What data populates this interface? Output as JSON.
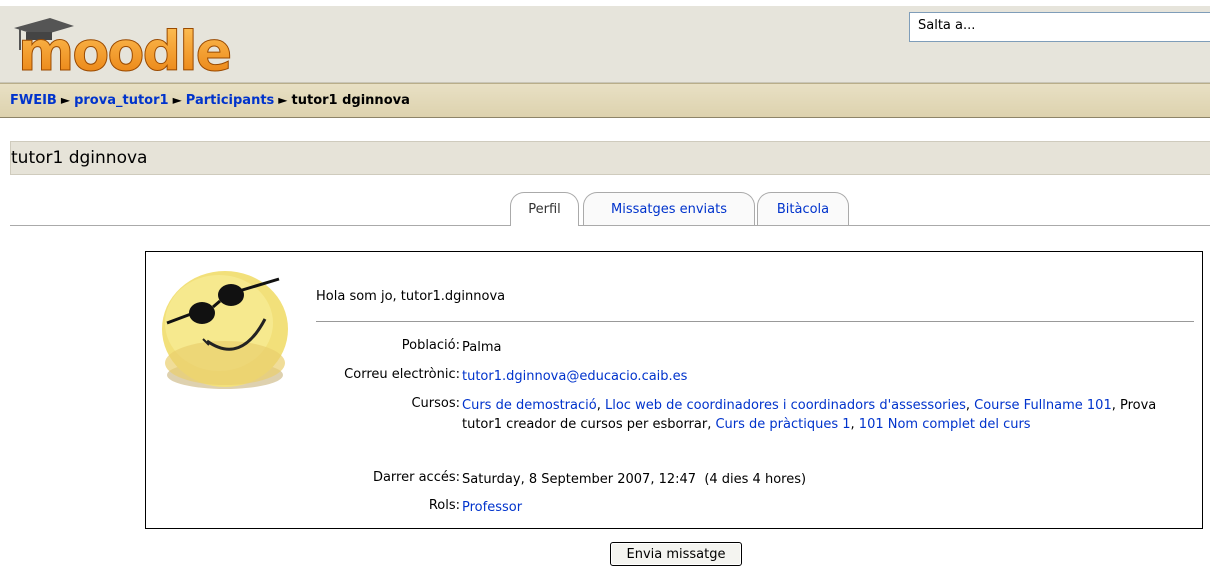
{
  "header": {
    "logo_text": "moodle",
    "jump_menu": "Salta a..."
  },
  "breadcrumb": {
    "items": [
      {
        "label": "FWEIB",
        "link": false
      },
      {
        "label": "prova_tutor1",
        "link": true
      },
      {
        "label": "Participants",
        "link": true
      },
      {
        "label": "tutor1 dginnova",
        "link": false
      }
    ],
    "separator": "►"
  },
  "page_title": "tutor1 dginnova",
  "tabs": [
    {
      "label": "Perfil",
      "active": true
    },
    {
      "label": "Missatges enviats",
      "active": false
    },
    {
      "label": "Bitàcola",
      "active": false
    }
  ],
  "profile": {
    "description": "Hola som jo, tutor1.dginnova",
    "fields": {
      "city_label": "Població:",
      "city_value": "Palma",
      "email_label": "Correu electrònic:",
      "email_value": "tutor1.dginnova@educacio.caib.es",
      "courses_label": "Cursos:",
      "courses": [
        {
          "label": "Curs de demostració",
          "link": true
        },
        {
          "label": "Lloc web de coordinadores i coordinadors d'assessories",
          "link": true
        },
        {
          "label": "Course Fullname 101",
          "link": true
        },
        {
          "label": "Prova tutor1 creador de cursos per esborrar",
          "link": false
        },
        {
          "label": "Curs de pràctiques 1",
          "link": true
        },
        {
          "label": "101 Nom complet del curs",
          "link": true
        }
      ],
      "last_access_label": "Darrer accés:",
      "last_access_value": "Saturday, 8 September 2007, 12:47  (4 dies 4 hores)",
      "roles_label": "Rols:",
      "roles_value": "Professor"
    }
  },
  "send_message_button": "Envia missatge",
  "colors": {
    "link": "#0033cc",
    "header_bg": "#e6e4db",
    "navbar_bg": "#ddd2ae",
    "logo_orange": "#f7941d"
  }
}
